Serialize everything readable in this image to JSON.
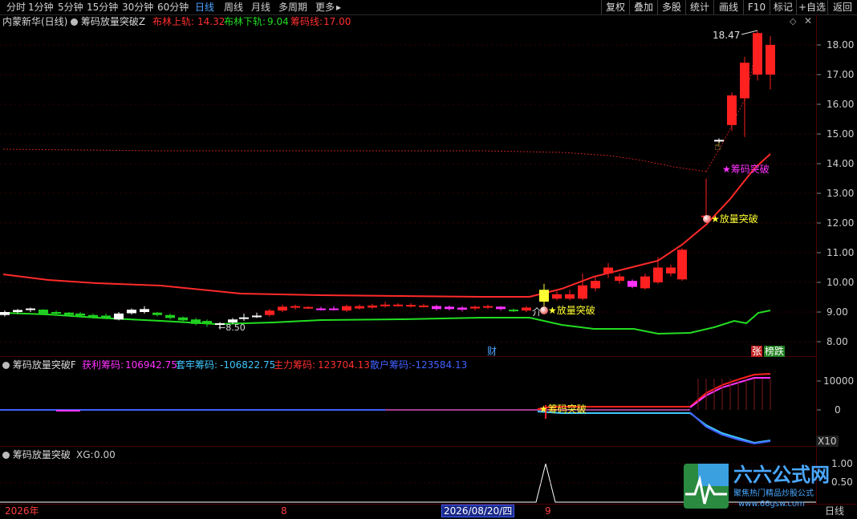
{
  "toolbar": {
    "periods": [
      "分时",
      "1分钟",
      "5分钟",
      "15分钟",
      "30分钟",
      "60分钟",
      "日线",
      "周线",
      "月线",
      "多周期",
      "更多"
    ],
    "active_period": "日线",
    "more_arrow": "▸",
    "buttons": [
      "复权",
      "叠加",
      "多股",
      "统计",
      "画线",
      "F10",
      "标记",
      "+自选",
      "返回"
    ]
  },
  "main_panel": {
    "stock_title": "内蒙新华(日线)",
    "indicator_name": "筹码放量突破Z",
    "bollinger_upper_label": "布林上轨:",
    "bollinger_upper_value": "14.32",
    "bollinger_lower_label": "布林下轨:",
    "bollinger_lower_value": "9.04",
    "chip_line_label": "筹码线:",
    "chip_line_value": "17.00",
    "price_ticks": [
      "18.00",
      "17.00",
      "16.00",
      "15.00",
      "14.00",
      "13.00",
      "12.00",
      "11.00",
      "10.00",
      "9.00",
      "8.00"
    ],
    "high_annotation": "18.47",
    "low_annotation": "8.50",
    "signal_volume_breakout": "放量突破",
    "signal_chip_breakout": "筹码突破",
    "finance_marker": "财",
    "limit_up_marker": "张",
    "rank_marker": "榜跌",
    "jie_marker": "介"
  },
  "sub_panel_1": {
    "indicator_name": "筹码放量突破F",
    "profit_label": "获利筹码:",
    "profit_value": "106942.75",
    "trapped_label": "套牢筹码:",
    "trapped_value": "-106822.75",
    "main_label": "主力筹码:",
    "main_value": "123704.13",
    "retail_label": "散户筹码:",
    "retail_value": "-123584.13",
    "ticks": [
      "10000",
      "0"
    ],
    "signal_label": "筹码突破",
    "scale_label": "X10"
  },
  "sub_panel_2": {
    "indicator_name": "筹码放量突破",
    "xg_label": "XG:",
    "xg_value": "0.00",
    "ticks": [
      "1.00",
      "0.50"
    ]
  },
  "time_axis": {
    "year_label": "2026年",
    "month_8": "8",
    "cursor_date": "2026/08/20/四",
    "month_9": "9",
    "period_label": "日线"
  },
  "watermark": {
    "brand": "六六公式网",
    "tagline": "聚焦热门精品炒股公式",
    "url": "www.66gsw.com"
  },
  "colors": {
    "up": "#ff2020",
    "down": "#20d020",
    "bollinger_upper": "#ff2a2a",
    "bollinger_lower": "#22dd22",
    "chip_line": "#c02020",
    "magenta": "#ff33ff",
    "yellow": "#ffff33",
    "blue": "#4060ff",
    "cyan": "#40c8ff"
  }
}
